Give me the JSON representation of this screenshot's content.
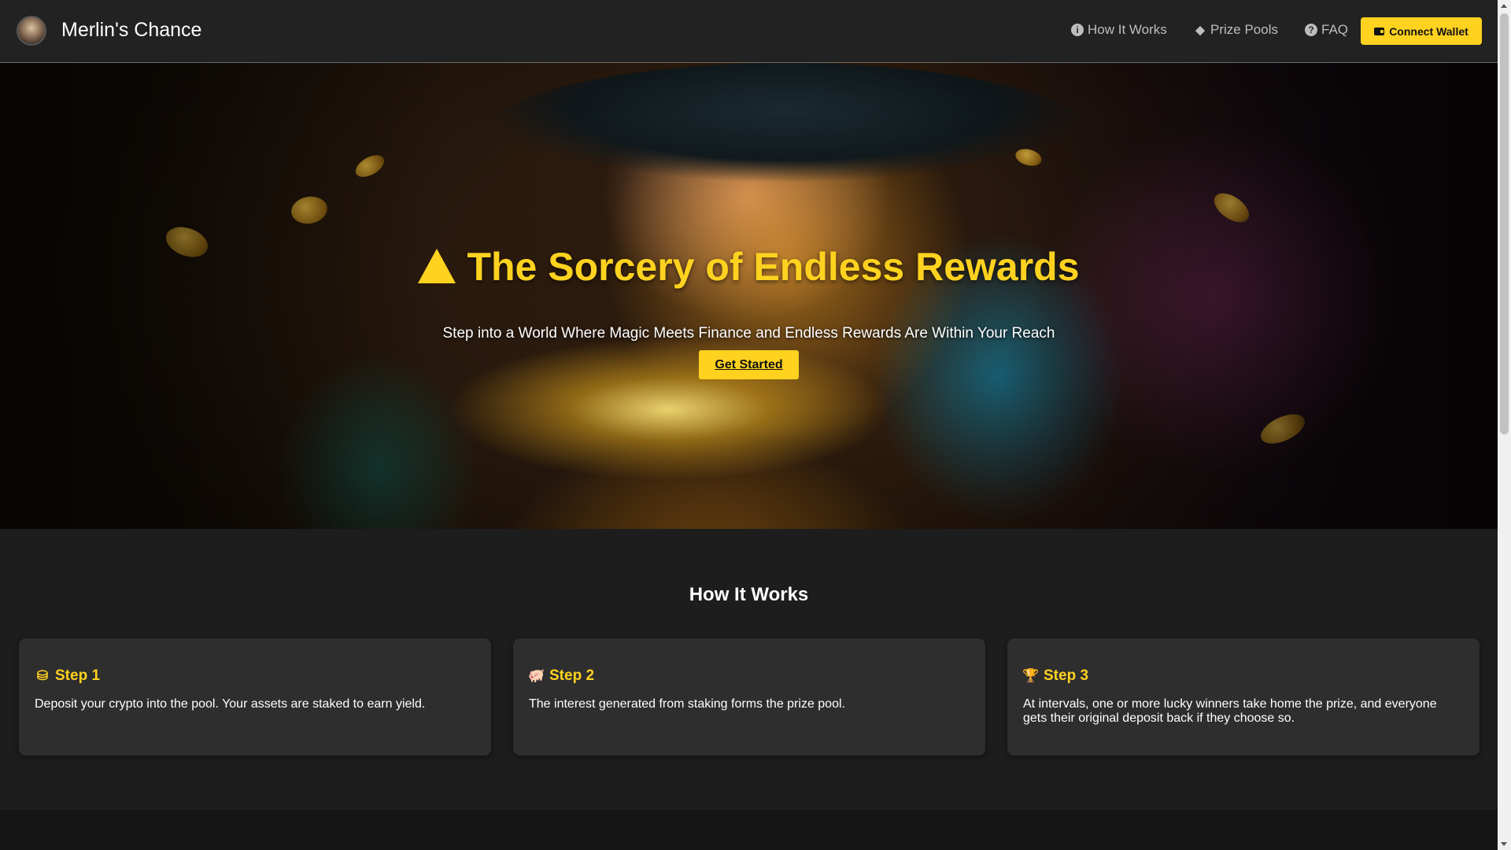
{
  "header": {
    "brand": "Merlin's Chance",
    "logo_icon": "wizard-avatar-icon",
    "nav": [
      {
        "label": "How It Works",
        "icon": "info-circle-icon"
      },
      {
        "label": "Prize Pools",
        "icon": "gem-icon"
      },
      {
        "label": "FAQ",
        "icon": "question-circle-icon"
      }
    ],
    "connect_wallet": "Connect Wallet",
    "connect_wallet_icon": "wallet-icon"
  },
  "hero": {
    "title": "The Sorcery of Endless Rewards",
    "title_icon": "wizard-hat-icon",
    "subtitle": "Step into a World Where Magic Meets Finance and Endless Rewards Are Within Your Reach",
    "cta": "Get Started"
  },
  "how_it_works": {
    "title": "How It Works",
    "steps": [
      {
        "title": "Step 1",
        "icon": "coins-icon",
        "text": "Deposit your crypto into the pool. Your assets are staked to earn yield."
      },
      {
        "title": "Step 2",
        "icon": "piggy-bank-icon",
        "text": "The interest generated from staking forms the prize pool."
      },
      {
        "title": "Step 3",
        "icon": "trophy-icon",
        "text": "At intervals, one or more lucky winners take home the prize, and everyone gets their original deposit back if they choose so."
      }
    ]
  },
  "colors": {
    "accent": "#ffd21f",
    "header_bg": "#222222",
    "page_bg": "#1d1d1d",
    "card_bg": "#2e2e2e"
  }
}
